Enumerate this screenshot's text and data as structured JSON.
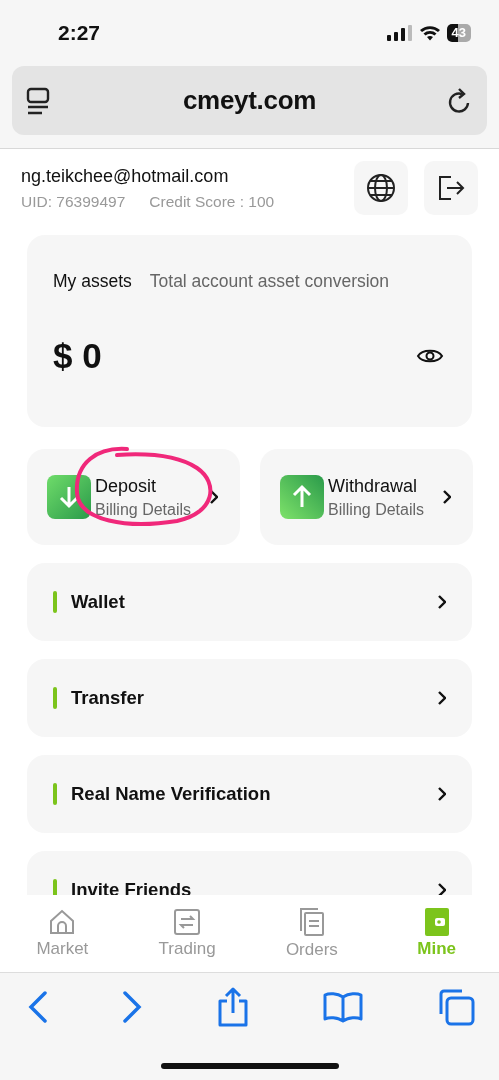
{
  "status_bar": {
    "time": "2:27",
    "battery": "43"
  },
  "browser": {
    "url": "cmeyt.com"
  },
  "user": {
    "email": "ng.teikchee@hotmail.com",
    "uid": "UID: 76399497",
    "credit_score": "Credit Score : 100"
  },
  "assets": {
    "title": "My assets",
    "subtitle": "Total account asset conversion",
    "amount": "$ 0"
  },
  "actions": [
    {
      "kind": "deposit",
      "title": "Deposit",
      "subtitle": "Billing Details"
    },
    {
      "kind": "withdrawal",
      "title": "Withdrawal",
      "subtitle": "Billing Details"
    }
  ],
  "menu": [
    {
      "label": "Wallet"
    },
    {
      "label": "Transfer"
    },
    {
      "label": "Real Name Verification"
    },
    {
      "label": "Invite Friends"
    }
  ],
  "tabs": [
    {
      "kind": "market",
      "label": "Market",
      "selected": false
    },
    {
      "kind": "trading",
      "label": "Trading",
      "selected": false
    },
    {
      "kind": "orders",
      "label": "Orders",
      "selected": false
    },
    {
      "kind": "mine",
      "label": "Mine",
      "selected": true
    }
  ]
}
